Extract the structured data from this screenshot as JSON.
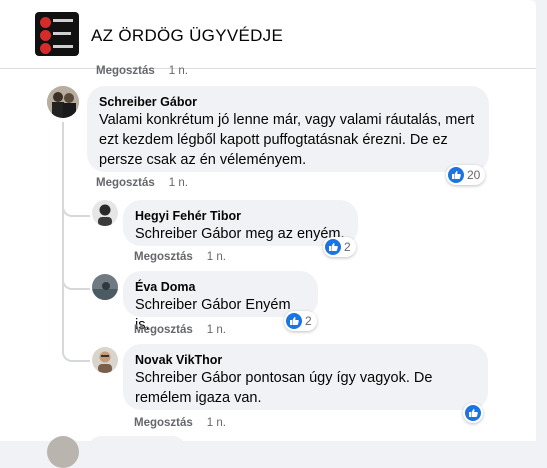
{
  "group": {
    "title": "AZ ÖRDÖG ÜGYVÉDJE"
  },
  "top_meta": {
    "share": "Megosztás",
    "time": "1 n."
  },
  "comments": [
    {
      "author": "Schreiber Gábor",
      "text": "Valami konkrétum jó lenne már, vagy valami ráutalás, mert ezt kezdem légből kapott puffogtatásnak érezni. De ez persze csak az én véleményem.",
      "share": "Megosztás",
      "time": "1 n.",
      "reactions": "20"
    }
  ],
  "replies": [
    {
      "author": "Hegyi Fehér Tibor",
      "text": "Schreiber Gábor meg az enyém.",
      "share": "Megosztás",
      "time": "1 n.",
      "reactions": "2"
    },
    {
      "author": "Éva Doma",
      "text": "Schreiber Gábor Enyém is.",
      "share": "Megosztás",
      "time": "1 n.",
      "reactions": "2"
    },
    {
      "author": "Novak VikThor",
      "text": "Schreiber Gábor pontosan úgy így vagyok. De remélem igaza van.",
      "share": "Megosztás",
      "time": "1 n.",
      "reactions": ""
    }
  ],
  "colors": {
    "like_blue": "#1b74e4",
    "bubble_bg": "#f0f2f5",
    "meta_gray": "#65676b"
  },
  "icons": [
    "like-icon"
  ]
}
